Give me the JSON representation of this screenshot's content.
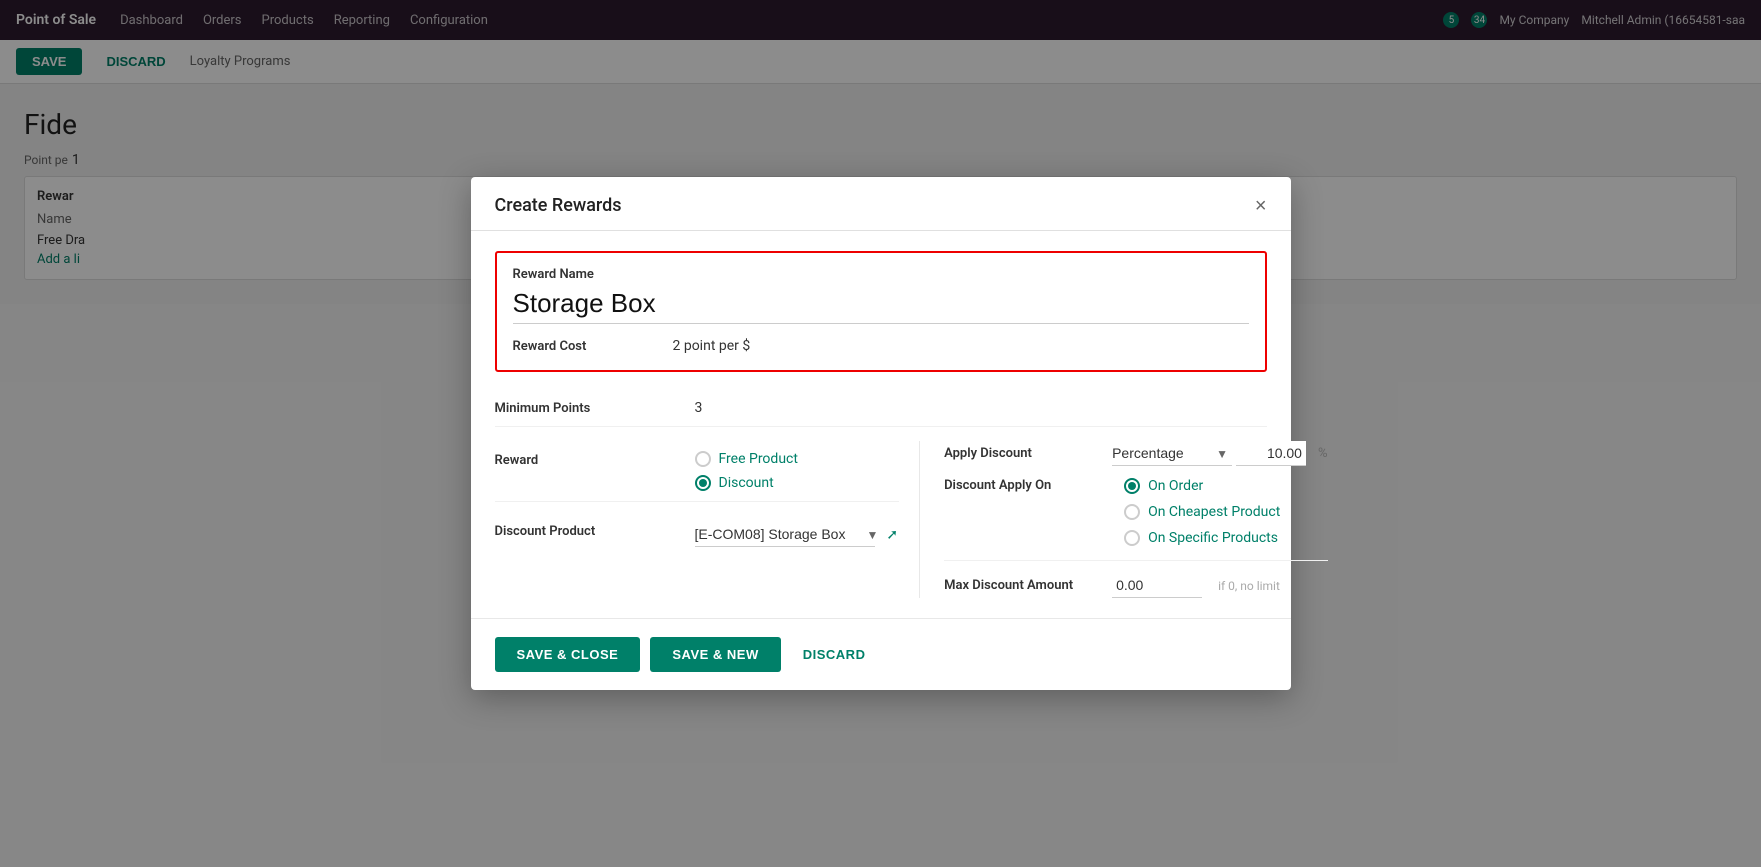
{
  "app": {
    "brand": "Point of Sale",
    "nav": [
      "Dashboard",
      "Orders",
      "Products",
      "Reporting",
      "Configuration"
    ],
    "user": "Mitchell Admin (16654581-saa",
    "company": "My Company",
    "badge5": "5",
    "badge34": "34"
  },
  "subbar": {
    "save_label": "SAVE",
    "discard_label": "DISCARD",
    "breadcrumb": "Loyalty Programs"
  },
  "page": {
    "title": "Fide",
    "point_per_label": "Point pe",
    "point_per_value": "1",
    "rewards_label": "Rewar",
    "reward_name_col": "Name",
    "reward_row": "Free Dra",
    "add_line": "Add a li"
  },
  "modal": {
    "title": "Create Rewards",
    "close_label": "×",
    "reward_name_label": "Reward Name",
    "reward_name_value": "Storage Box",
    "reward_cost_label": "Reward Cost",
    "reward_cost_value": "2 point per $",
    "minimum_points_label": "Minimum Points",
    "minimum_points_value": "3",
    "reward_label": "Reward",
    "reward_options": [
      {
        "id": "free_product",
        "label": "Free Product",
        "checked": false
      },
      {
        "id": "discount",
        "label": "Discount",
        "checked": true
      }
    ],
    "discount_product_label": "Discount Product",
    "discount_product_value": "[E-COM08] Storage Box",
    "apply_discount_label": "Apply Discount",
    "apply_discount_type": "Percentage",
    "apply_discount_value": "10.00",
    "apply_discount_pct": "%",
    "discount_apply_on_label": "Discount Apply On",
    "discount_apply_on_options": [
      {
        "id": "on_order",
        "label": "On Order",
        "checked": true
      },
      {
        "id": "on_cheapest",
        "label": "On Cheapest Product",
        "checked": false
      },
      {
        "id": "on_specific",
        "label": "On Specific Products",
        "checked": false
      }
    ],
    "max_discount_label": "Max Discount Amount",
    "max_discount_value": "0.00",
    "max_discount_hint": "if 0, no limit",
    "footer": {
      "save_close": "SAVE & CLOSE",
      "save_new": "SAVE & NEW",
      "discard": "DISCARD"
    }
  }
}
